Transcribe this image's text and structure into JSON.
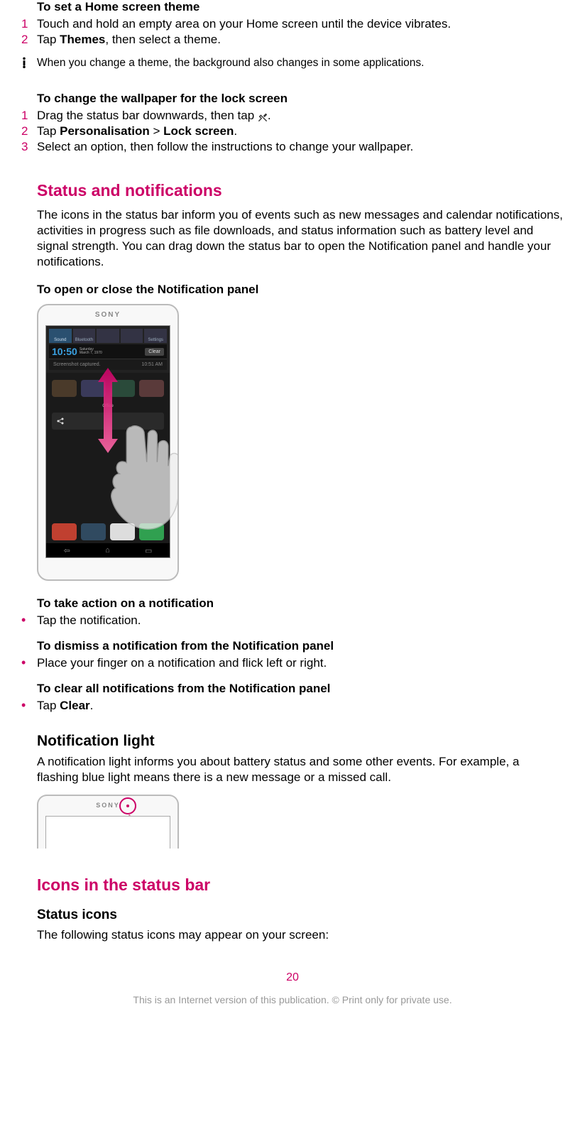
{
  "sec1": {
    "title": "To set a Home screen theme",
    "steps": [
      {
        "n": "1",
        "text_a": "Touch and hold an empty area on your Home screen until the device vibrates."
      },
      {
        "n": "2",
        "text_a": "Tap ",
        "bold": "Themes",
        "text_b": ", then select a theme."
      }
    ],
    "note": "When you change a theme, the background also changes in some applications."
  },
  "sec2": {
    "title": "To change the wallpaper for the lock screen",
    "steps": [
      {
        "n": "1",
        "text_a": "Drag the status bar downwards, then tap ",
        "text_b": "."
      },
      {
        "n": "2",
        "text_a": "Tap ",
        "bold": "Personalisation",
        "mid": " > ",
        "bold2": "Lock screen",
        "text_b": "."
      },
      {
        "n": "3",
        "text_a": "Select an option, then follow the instructions to change your wallpaper."
      }
    ]
  },
  "status_notif": {
    "heading": "Status and notifications",
    "para": "The icons in the status bar inform you of events such as new messages and calendar notifications, activities in progress such as file downloads, and status information such as battery level and signal strength. You can drag down the status bar to open the Notification panel and handle your notifications.",
    "open_close_title": "To open or close the Notification panel"
  },
  "phone": {
    "brand": "SONY",
    "toggles": [
      "Sound",
      "Bluetooth",
      "",
      "",
      "Settings"
    ],
    "time": "10:50",
    "date_a": "Saturday",
    "date_b": "March 7, 1970",
    "clear": "Clear",
    "notif_a": "Screenshot captured.",
    "notif_time": "10:51 AM",
    "office": "Office",
    "nav": [
      "⇦",
      "⌂",
      "▭"
    ]
  },
  "take_action": {
    "title": "To take action on a notification",
    "bullet": "Tap the notification."
  },
  "dismiss": {
    "title": "To dismiss a notification from the Notification panel",
    "bullet": "Place your finger on a notification and flick left or right."
  },
  "clear_all": {
    "title": "To clear all notifications from the Notification panel",
    "bullet_a": "Tap ",
    "bullet_bold": "Clear",
    "bullet_b": "."
  },
  "notif_light": {
    "heading": "Notification light",
    "para": "A notification light informs you about battery status and some other events. For example, a flashing blue light means there is a new message or a missed call."
  },
  "icons_bar": {
    "heading": "Icons in the status bar",
    "sub": "Status icons",
    "para": "The following status icons may appear on your screen:"
  },
  "page_number": "20",
  "footer": "This is an Internet version of this publication. © Print only for private use."
}
